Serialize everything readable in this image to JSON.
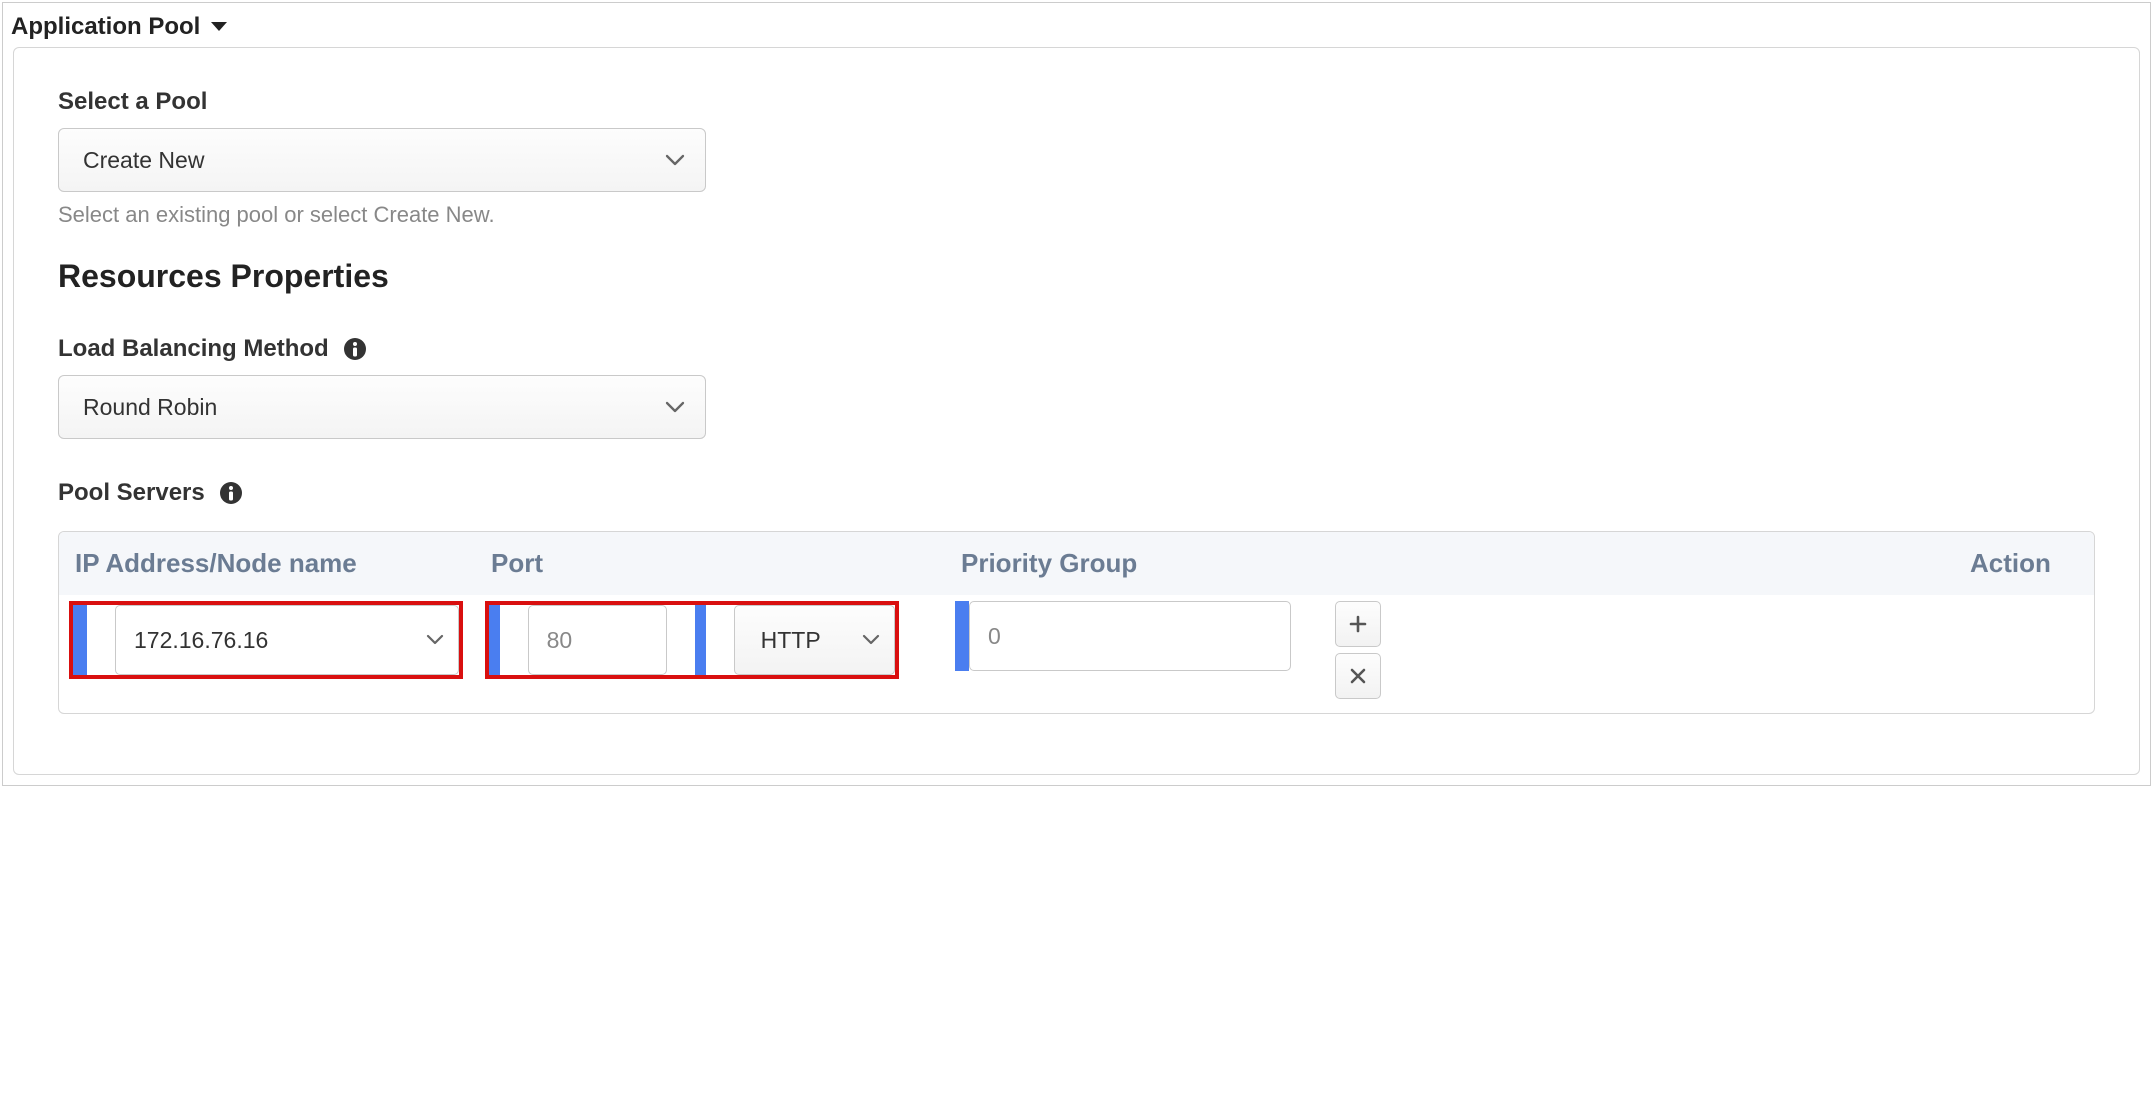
{
  "header": {
    "title": "Application Pool"
  },
  "pool": {
    "select_label": "Select a Pool",
    "select_value": "Create New",
    "helper": "Select an existing pool or select Create New."
  },
  "resources": {
    "title": "Resources Properties",
    "lb_label": "Load Balancing Method",
    "lb_value": "Round Robin",
    "servers_label": "Pool Servers"
  },
  "table": {
    "headers": {
      "ip": "IP Address/Node name",
      "port": "Port",
      "priority": "Priority Group",
      "action": "Action"
    },
    "row": {
      "ip": "172.16.76.16",
      "port": "80",
      "protocol": "HTTP",
      "priority": "0"
    }
  }
}
